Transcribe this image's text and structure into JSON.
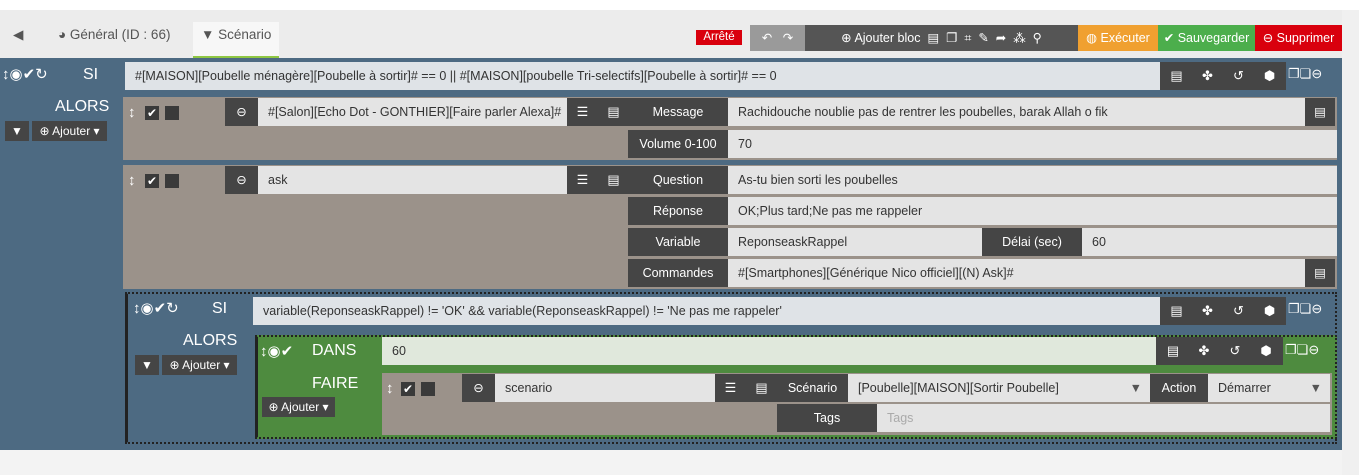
{
  "tabs": {
    "back_icon": "arrow-circle-left",
    "general": "Général (ID : 66)",
    "scenario": "Scénario"
  },
  "toolbar": {
    "status": "Arrêté",
    "add_block": "Ajouter bloc",
    "execute": "Exécuter",
    "save": "Sauvegarder",
    "delete": "Supprimer",
    "colors": {
      "status": "#d9000d",
      "execute": "#f0a030",
      "save": "#4cae4c",
      "delete": "#d9000d"
    }
  },
  "si1": {
    "label": "SI",
    "condition": "#[MAISON][Poubelle ménagère][Poubelle à sortir]# == 0 || #[MAISON][poubelle Tri-selectifs][Poubelle à sortir]# == 0",
    "then": "ALORS",
    "add": "Ajouter"
  },
  "action1": {
    "cmd": "#[Salon][Echo Dot  - GONTHIER][Faire parler Alexa]#",
    "message_label": "Message",
    "message": "Rachidouche noublie pas de rentrer les poubelles, barak Allah o fik",
    "volume_label": "Volume 0-100",
    "volume": "70"
  },
  "action2": {
    "cmd": "ask",
    "question_label": "Question",
    "question": "As-tu bien sorti les poubelles",
    "response_label": "Réponse",
    "response": "OK;Plus tard;Ne pas me rappeler",
    "variable_label": "Variable",
    "variable": "ReponseaskRappel",
    "delay_label": "Délai (sec)",
    "delay": "60",
    "commands_label": "Commandes",
    "commands": "#[Smartphones][Générique Nico officiel][(N) Ask]#"
  },
  "si2": {
    "label": "SI",
    "condition": "variable(ReponseaskRappel) != 'OK' && variable(ReponseaskRappel) != 'Ne pas me rappeler'",
    "then": "ALORS",
    "add": "Ajouter"
  },
  "dans": {
    "label": "DANS",
    "value": "60",
    "do": "FAIRE",
    "add": "Ajouter"
  },
  "action3": {
    "cmd": "scenario",
    "scenario_label": "Scénario",
    "scenario": "[Poubelle][MAISON][Sortir Poubelle]",
    "action_label": "Action",
    "action": "Démarrer",
    "tags_label": "Tags",
    "tags_placeholder": "Tags"
  }
}
